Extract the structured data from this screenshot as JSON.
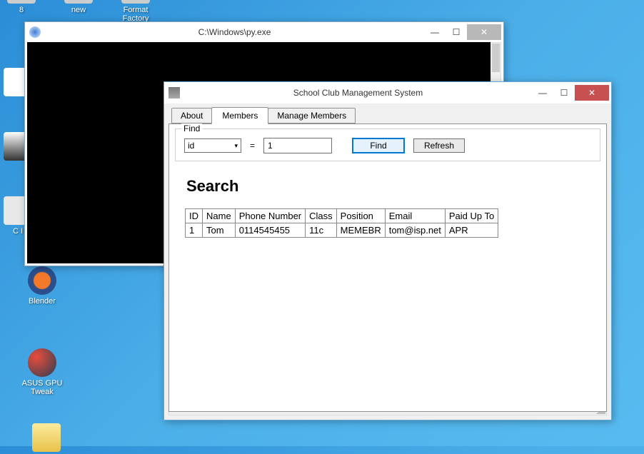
{
  "desktop": {
    "icons": [
      {
        "label": "8"
      },
      {
        "label": "new"
      },
      {
        "label": "Format Factory"
      },
      {
        "label": "C I"
      },
      {
        "label": "Blender"
      },
      {
        "label": "ASUS GPU Tweak"
      }
    ]
  },
  "pywin": {
    "title": "C:\\Windows\\py.exe",
    "controls": {
      "min": "—",
      "max": "☐",
      "close": "✕"
    }
  },
  "clubwin": {
    "title": "School Club Management System",
    "controls": {
      "min": "—",
      "max": "☐",
      "close": "✕"
    },
    "tabs": [
      {
        "label": "About"
      },
      {
        "label": "Members"
      },
      {
        "label": "Manage Members"
      }
    ],
    "find": {
      "legend": "Find",
      "field_selected": "id",
      "equals": "=",
      "value": "1",
      "find_btn": "Find",
      "refresh_btn": "Refresh"
    },
    "heading": "Search",
    "table": {
      "headers": [
        "ID",
        "Name",
        "Phone Number",
        "Class",
        "Position",
        "Email",
        "Paid Up To"
      ],
      "rows": [
        [
          "1",
          "Tom",
          "0114545455",
          "11c",
          "MEMEBR",
          "tom@isp.net",
          "APR"
        ]
      ]
    }
  }
}
